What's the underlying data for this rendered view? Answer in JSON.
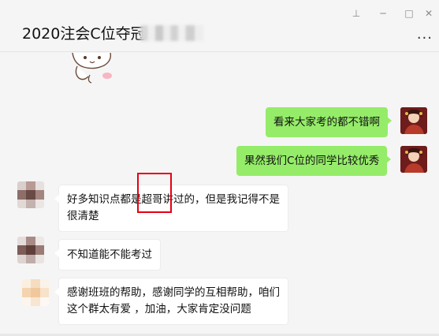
{
  "window": {
    "title": "2020注会C位夺冠",
    "controls": {
      "pin": "⊥",
      "minimize": "─",
      "maximize": "□",
      "close": "✕"
    },
    "more": "···"
  },
  "messages": [
    {
      "side": "me",
      "text": "看来大家考的都不错啊"
    },
    {
      "side": "me",
      "text": "果然我们C位的同学比较优秀"
    },
    {
      "side": "other",
      "lines": [
        "好多知识点都是超哥讲过的，但是我记得不是",
        "很清楚"
      ]
    },
    {
      "side": "other",
      "lines": [
        "不知道能不能考过"
      ]
    },
    {
      "side": "other",
      "lines": [
        "感谢班班的帮助，感谢同学的互相帮助，咱们",
        "这个群太有爱 ，加油，大家肯定没问题"
      ]
    }
  ],
  "colors": {
    "my_bubble": "#95ec69",
    "other_bubble": "#ffffff",
    "highlight_box": "#e60012",
    "background": "#f5f5f5"
  }
}
